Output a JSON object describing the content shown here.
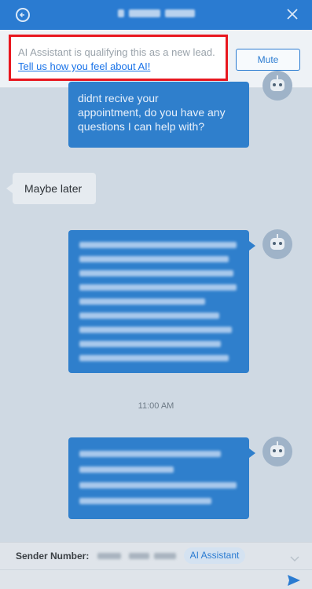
{
  "header": {
    "back_icon": "back-arrow-icon",
    "close_icon": "close-icon",
    "color": "#2a7bd1"
  },
  "banner": {
    "notice": "AI Assistant is qualifying this as a new lead.",
    "feedback_link": "Tell us how you feel about AI!",
    "mute_label": "Mute"
  },
  "messages": [
    {
      "direction": "outgoing",
      "text": "didnt recive your\nappointment, do you have any\nquestions I can help with?"
    },
    {
      "direction": "incoming",
      "text": "Maybe later"
    },
    {
      "direction": "outgoing",
      "text": ""
    },
    {
      "direction": "outgoing",
      "text": ""
    }
  ],
  "timestamp": "11:00 AM",
  "footer": {
    "sender_label": "Sender Number:",
    "chip_label": "AI Assistant",
    "expand_icon": "chevron-down-icon",
    "send_icon": "send-icon"
  }
}
